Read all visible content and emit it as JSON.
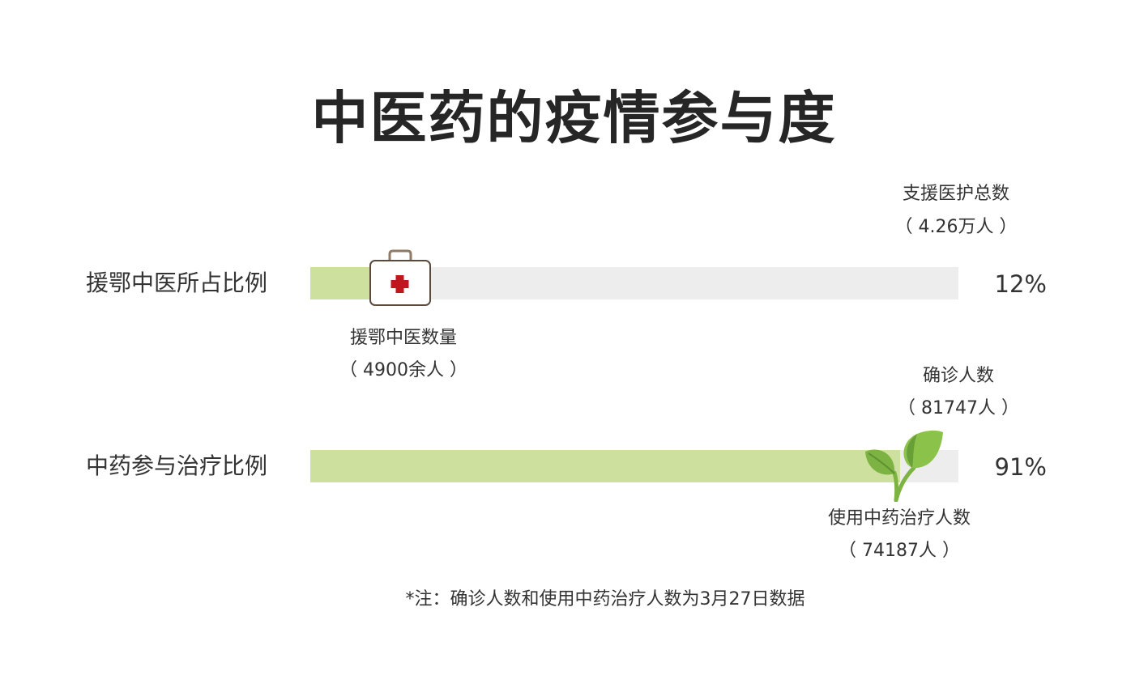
{
  "title": "中医药的疫情参与度",
  "chart_data": {
    "type": "bar",
    "orientation": "horizontal",
    "categories": [
      "援鄂中医所占比例",
      "中药参与治疗比例"
    ],
    "values": [
      12,
      91
    ],
    "value_labels": [
      "12%",
      "91%"
    ],
    "xlim": [
      0,
      100
    ],
    "colors": {
      "fill": "#cde09d",
      "track": "#ededed"
    },
    "annotations": [
      {
        "total_title": "支援医护总数",
        "total_value": "（ 4.26万人 ）",
        "part_title": "援鄂中医数量",
        "part_value": "（ 4900余人 ）",
        "marker_icon": "medical-kit-icon"
      },
      {
        "total_title": "确诊人数",
        "total_value": "（ 81747人 ）",
        "part_title": "使用中药治疗人数",
        "part_value": "（ 74187人 ）",
        "marker_icon": "sprout-icon"
      }
    ]
  },
  "footnote": "*注：确诊人数和使用中药治疗人数为3月27日数据"
}
